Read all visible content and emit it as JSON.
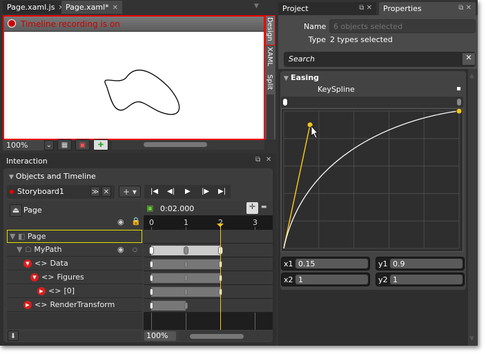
{
  "doc_tabs": [
    {
      "label": "Page.xaml.js",
      "active": false
    },
    {
      "label": "Page.xaml*",
      "active": true
    }
  ],
  "artboard": {
    "recording_text": "Timeline recording is on",
    "recording_color": "#cc0000",
    "view_tabs": [
      "Design",
      "XAML",
      "Split"
    ],
    "zoom": "100%"
  },
  "interaction": {
    "title": "Interaction",
    "section": "Objects and Timeline",
    "storyboard": "Storyboard1",
    "scope": "Page",
    "time": "0:02.000",
    "ruler_ticks": [
      "0",
      "1",
      "2",
      "3"
    ],
    "playhead_seconds": 2,
    "timeline_zoom": "100%",
    "tree": [
      {
        "label": "Page",
        "level": 0
      },
      {
        "label": "MyPath",
        "level": 1
      },
      {
        "label": "Data",
        "level": 2
      },
      {
        "label": "Figures",
        "level": 3
      },
      {
        "label": "[0]",
        "level": 4
      },
      {
        "label": "RenderTransform",
        "level": 2
      }
    ],
    "keyframes_seconds": [
      [],
      [
        0,
        1,
        2
      ],
      [
        0,
        1,
        2
      ],
      [
        0,
        1,
        2
      ],
      [
        0,
        1,
        2
      ],
      [
        0,
        1
      ]
    ]
  },
  "right_tabs": [
    {
      "label": "Project",
      "active": false
    },
    {
      "label": "Properties",
      "active": true
    }
  ],
  "properties": {
    "name_label": "Name",
    "name_placeholder": "6 objects selected",
    "type_label": "Type",
    "type_value": "2 types selected",
    "search_placeholder": "Search",
    "section": "Easing",
    "keyspline_label": "KeySpline",
    "fields": [
      {
        "label": "x1",
        "value": "0.15"
      },
      {
        "label": "y1",
        "value": "0.9"
      },
      {
        "label": "x2",
        "value": "1"
      },
      {
        "label": "y2",
        "value": "1"
      }
    ],
    "accent": "#f5c518"
  }
}
